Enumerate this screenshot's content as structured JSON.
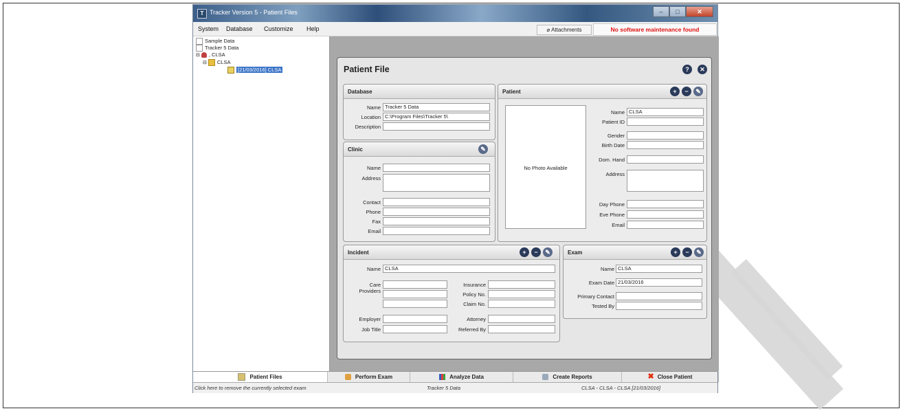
{
  "window": {
    "title": "Tracker Version 5 - Patient Files",
    "menu": [
      "System",
      "Database",
      "Customize",
      "Help"
    ],
    "attachments_label": "Attachments",
    "maintenance_notice": "No software maintenance found"
  },
  "tree": {
    "items": [
      "Sample Data",
      "Tracker 5 Data",
      ", CLSA",
      "CLSA",
      "[21/03/2016] CLSA"
    ]
  },
  "panel": {
    "title": "Patient File",
    "database": {
      "title": "Database",
      "name_label": "Name",
      "name_value": "Tracker 5 Data",
      "location_label": "Location",
      "location_value": "C:\\Program Files\\Tracker 5\\",
      "description_label": "Description",
      "description_value": ""
    },
    "clinic": {
      "title": "Clinic",
      "name_label": "Name",
      "address_label": "Address",
      "contact_label": "Contact",
      "phone_label": "Phone",
      "fax_label": "Fax",
      "email_label": "Email"
    },
    "patient": {
      "title": "Patient",
      "photo_text": "No Photo Available",
      "name_label": "Name",
      "name_value": "CLSA",
      "patient_id_label": "Patient ID",
      "gender_label": "Gender",
      "birth_date_label": "Birth Date",
      "dom_hand_label": "Dom. Hand",
      "address_label": "Address",
      "day_phone_label": "Day Phone",
      "eve_phone_label": "Eve Phone",
      "email_label": "Email"
    },
    "incident": {
      "title": "Incident",
      "name_label": "Name",
      "name_value": "CLSA",
      "care_providers_label_1": "Care",
      "care_providers_label_2": "Providers",
      "insurance_label": "Insurance",
      "policy_no_label": "Policy No.",
      "claim_no_label": "Claim No.",
      "employer_label": "Employer",
      "attorney_label": "Attorney",
      "job_title_label": "Job Title",
      "referred_by_label": "Referred By"
    },
    "exam": {
      "title": "Exam",
      "name_label": "Name",
      "name_value": "CLSA",
      "exam_date_label": "Exam Date",
      "exam_date_value": "21/03/2016",
      "primary_contact_label": "Primary Contact",
      "tested_by_label": "Tested By"
    }
  },
  "tabs": [
    "Patient Files",
    "Perform Exam",
    "Analyze Data",
    "Create Reports",
    "Close Patient"
  ],
  "status": {
    "hint": "Click here to remove the currently selected exam",
    "database": "Tracker 5 Data",
    "path": "CLSA - CLSA - CLSA [21/03/2016]"
  },
  "colors": {
    "warning": "#e01010",
    "selection": "#3b74c8",
    "client_bg": "#a8a8a8"
  }
}
